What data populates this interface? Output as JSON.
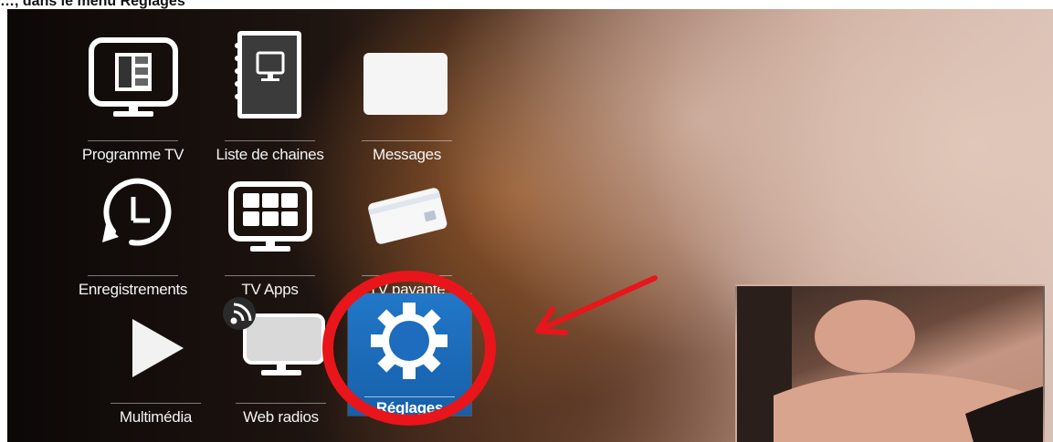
{
  "caption": {
    "text": "…, dans le menu Réglages"
  },
  "menu": {
    "items": [
      {
        "id": "programme-tv",
        "label": "Programme TV",
        "icon": "tv-guide-icon"
      },
      {
        "id": "liste-chaines",
        "label": "Liste de chaines",
        "icon": "channel-list-icon"
      },
      {
        "id": "messages",
        "label": "Messages",
        "icon": "messages-icon"
      },
      {
        "id": "enregistrements",
        "label": "Enregistrements",
        "icon": "clock-recordings-icon"
      },
      {
        "id": "tv-apps",
        "label": "TV Apps",
        "icon": "apps-grid-icon"
      },
      {
        "id": "tv-payante",
        "label": "TV payante",
        "icon": "smart-card-icon"
      },
      {
        "id": "multimedia",
        "label": "Multimédia",
        "icon": "play-icon"
      },
      {
        "id": "web-radios",
        "label": "Web radios",
        "icon": "web-radio-icon"
      },
      {
        "id": "reglages",
        "label": "Réglages",
        "icon": "gear-icon",
        "selected": true
      }
    ]
  },
  "annotation": {
    "circle_color": "#e8151b",
    "arrow_color": "#e8151b",
    "selected_tile_color": "#1f6fbf"
  }
}
